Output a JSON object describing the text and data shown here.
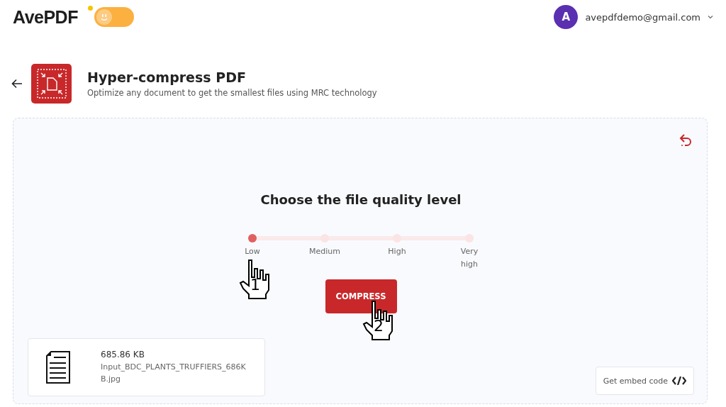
{
  "header": {
    "logo": "AvePDF",
    "theme_toggle": {
      "on": false
    },
    "account": {
      "avatar_letter": "A",
      "email": "avepdfdemo@gmail.com"
    }
  },
  "tool": {
    "title": "Hyper-compress PDF",
    "subtitle": "Optimize any document to get the smallest files using MRC technology"
  },
  "panel": {
    "heading": "Choose the file quality level",
    "levels": [
      {
        "label": "Low",
        "selected": true
      },
      {
        "label": "Medium",
        "selected": false
      },
      {
        "label": "High",
        "selected": false
      },
      {
        "label": "Very high",
        "selected": false
      }
    ],
    "button": "COMPRESS",
    "file": {
      "size": "685.86 KB",
      "name": "Input_BDC_PLANTS_TRUFFIERS_686KB.jpg"
    },
    "embed_button": "Get embed code"
  },
  "annotations": [
    {
      "label": "1"
    },
    {
      "label": "2"
    }
  ]
}
